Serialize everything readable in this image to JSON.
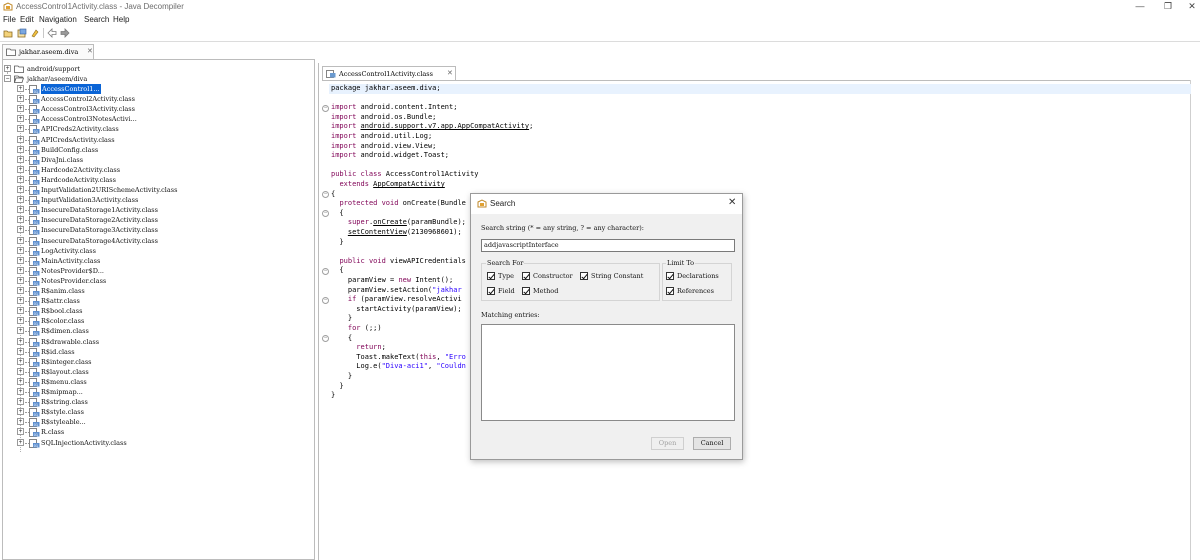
{
  "window": {
    "title": "AccessControl1Activity.class - Java Decompiler",
    "controls": [
      "—",
      "❐",
      "✕"
    ]
  },
  "menu": [
    "File",
    "Edit",
    "Navigation",
    "Search",
    "Help"
  ],
  "file_tab": "jakhar.aseem.diva",
  "tree": {
    "roots": [
      {
        "label": "android/support",
        "expander": "+"
      },
      {
        "label": "jakhar/aseem/diva",
        "expander": "−"
      }
    ],
    "classes": [
      "AccessControl1...",
      "AccessControl2Activity.class",
      "AccessControl3Activity.class",
      "AccessControl3NotesActivi...",
      "APICreds2Activity.class",
      "APICredsActivity.class",
      "BuildConfig.class",
      "DivaJni.class",
      "Hardcode2Activity.class",
      "HardcodeActivity.class",
      "InputValidation2URISchemeActivity.class",
      "InputValidation3Activity.class",
      "InsecureDataStorage1Activity.class",
      "InsecureDataStorage2Activity.class",
      "InsecureDataStorage3Activity.class",
      "InsecureDataStorage4Activity.class",
      "LogActivity.class",
      "MainActivity.class",
      "NotesProvider$D...",
      "NotesProvider.class",
      "R$anim.class",
      "R$attr.class",
      "R$bool.class",
      "R$color.class",
      "R$dimen.class",
      "R$drawable.class",
      "R$id.class",
      "R$integer.class",
      "R$layout.class",
      "R$menu.class",
      "R$mipmap...",
      "R$string.class",
      "R$style.class",
      "R$styleable...",
      "R.class",
      "SQLInjectionActivity.class"
    ],
    "selected_index": 0
  },
  "editor": {
    "tab": "AccessControl1Activity.class",
    "lines": [
      [
        {
          "t": "package jakhar.aseem.diva;"
        }
      ],
      [
        {
          "t": ""
        }
      ],
      [
        {
          "t": "import",
          "c": "kw"
        },
        {
          "t": " android.content.Intent;"
        }
      ],
      [
        {
          "t": "import",
          "c": "kw"
        },
        {
          "t": " android.os.Bundle;"
        }
      ],
      [
        {
          "t": "import",
          "c": "kw"
        },
        {
          "t": " "
        },
        {
          "t": "android.support.v7.app.AppCompatActivity",
          "c": "link"
        },
        {
          "t": ";"
        }
      ],
      [
        {
          "t": "import",
          "c": "kw"
        },
        {
          "t": " android.util.Log;"
        }
      ],
      [
        {
          "t": "import",
          "c": "kw"
        },
        {
          "t": " android.view.View;"
        }
      ],
      [
        {
          "t": "import",
          "c": "kw"
        },
        {
          "t": " android.widget.Toast;"
        }
      ],
      [
        {
          "t": ""
        }
      ],
      [
        {
          "t": "public class",
          "c": "kw"
        },
        {
          "t": " AccessControl1Activity"
        }
      ],
      [
        {
          "t": "  "
        },
        {
          "t": "extends",
          "c": "kw"
        },
        {
          "t": " "
        },
        {
          "t": "AppCompatActivity",
          "c": "link"
        }
      ],
      [
        {
          "t": "{"
        }
      ],
      [
        {
          "t": "  "
        },
        {
          "t": "protected void",
          "c": "kw"
        },
        {
          "t": " onCreate(Bundle"
        }
      ],
      [
        {
          "t": "  {"
        }
      ],
      [
        {
          "t": "    "
        },
        {
          "t": "super",
          "c": "kw"
        },
        {
          "t": "."
        },
        {
          "t": "onCreate",
          "c": "link"
        },
        {
          "t": "(paramBundle);"
        }
      ],
      [
        {
          "t": "    "
        },
        {
          "t": "setContentView",
          "c": "link"
        },
        {
          "t": "(2130968601);"
        }
      ],
      [
        {
          "t": "  }"
        }
      ],
      [
        {
          "t": ""
        }
      ],
      [
        {
          "t": "  "
        },
        {
          "t": "public void",
          "c": "kw"
        },
        {
          "t": " viewAPICredentials"
        }
      ],
      [
        {
          "t": "  {"
        }
      ],
      [
        {
          "t": "    paramView = "
        },
        {
          "t": "new",
          "c": "kw"
        },
        {
          "t": " Intent();"
        }
      ],
      [
        {
          "t": "    paramView.setAction("
        },
        {
          "t": "\"jakhar",
          "c": "str"
        }
      ],
      [
        {
          "t": "    "
        },
        {
          "t": "if",
          "c": "kw"
        },
        {
          "t": " (paramView.resolveActivi"
        }
      ],
      [
        {
          "t": "      startActivity(paramView);"
        }
      ],
      [
        {
          "t": "    }"
        }
      ],
      [
        {
          "t": "    "
        },
        {
          "t": "for",
          "c": "kw"
        },
        {
          "t": " (;;)"
        }
      ],
      [
        {
          "t": "    {"
        }
      ],
      [
        {
          "t": "      "
        },
        {
          "t": "return",
          "c": "kw"
        },
        {
          "t": ";"
        }
      ],
      [
        {
          "t": "      Toast.makeText("
        },
        {
          "t": "this",
          "c": "kw"
        },
        {
          "t": ", "
        },
        {
          "t": "\"Erro",
          "c": "str"
        }
      ],
      [
        {
          "t": "      Log.e("
        },
        {
          "t": "\"Diva-aci1\"",
          "c": "str"
        },
        {
          "t": ", "
        },
        {
          "t": "\"Couldn",
          "c": "str"
        }
      ],
      [
        {
          "t": "    }"
        }
      ],
      [
        {
          "t": "  }"
        }
      ],
      [
        {
          "t": "}"
        }
      ]
    ]
  },
  "search_dialog": {
    "title": "Search",
    "close": "✕",
    "prompt": "Search string (* = any string, ? = any character):",
    "query": "addjavascriptInterface",
    "search_for_label": "Search For",
    "search_for": [
      {
        "label": "Type",
        "checked": true
      },
      {
        "label": "Constructor",
        "checked": true
      },
      {
        "label": "String Constant",
        "checked": true
      },
      {
        "label": "Field",
        "checked": true
      },
      {
        "label": "Method",
        "checked": true
      }
    ],
    "limit_to_label": "Limit To",
    "limit_to": [
      {
        "label": "Declarations",
        "checked": true
      },
      {
        "label": "References",
        "checked": true
      }
    ],
    "matching_label": "Matching entries:",
    "open_button": "Open",
    "cancel_button": "Cancel"
  }
}
